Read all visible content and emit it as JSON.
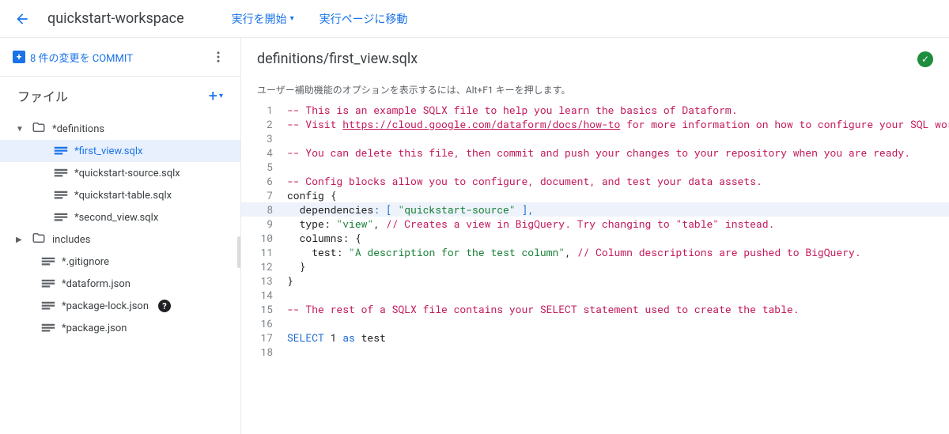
{
  "header": {
    "workspace": "quickstart-workspace",
    "start_execution": "実行を開始",
    "go_to_execution_page": "実行ページに移動"
  },
  "sidebar": {
    "commit_label": "8 件の変更を COMMIT",
    "files_title": "ファイル",
    "tree": {
      "definitions": "*definitions",
      "first_view": "*first_view.sqlx",
      "quickstart_source": "*quickstart-source.sqlx",
      "quickstart_table": "*quickstart-table.sqlx",
      "second_view": "*second_view.sqlx",
      "includes": "includes",
      "gitignore": "*.gitignore",
      "dataform_json": "*dataform.json",
      "package_lock": "*package-lock.json",
      "package_json": "*package.json"
    }
  },
  "content": {
    "file_path": "definitions/first_view.sqlx",
    "a11y_hint": "ユーザー補助機能のオプションを表示するには、Alt+F1 キーを押します。"
  },
  "code": {
    "l1_comment": "-- This is an example SQLX file to help you learn the basics of Dataform.",
    "l2_a": "-- Visit ",
    "l2_link": "https://cloud.google.com/dataform/docs/how-to",
    "l2_b": " for more information on how to configure your SQL workflo",
    "l4": "-- You can delete this file, then commit and push your changes to your repository when you are ready.",
    "l6": "-- Config blocks allow you to configure, document, and test your data assets.",
    "l7": "config {",
    "l8_key": "  dependencies",
    "l8_punc1": ": [ ",
    "l8_str": "\"quickstart-source\"",
    "l8_punc2": " ],",
    "l9_key": "  type",
    "l9_punc": ": ",
    "l9_str": "\"view\"",
    "l9_comma": ", ",
    "l9_comment": "// Creates a view in BigQuery. Try changing to \"table\" instead.",
    "l10_key": "  columns",
    "l10_rest": ": {",
    "l11_key": "    test",
    "l11_punc": ": ",
    "l11_str": "\"A description for the test column\"",
    "l11_comma": ", ",
    "l11_comment": "// Column descriptions are pushed to BigQuery.",
    "l12": "  }",
    "l13": "}",
    "l15": "-- The rest of a SQLX file contains your SELECT statement used to create the table.",
    "l17_select": "SELECT",
    "l17_num": " 1 ",
    "l17_as": "as",
    "l17_col": " test"
  },
  "gutter": {
    "n1": "1",
    "n2": "2",
    "n3": "3",
    "n4": "4",
    "n5": "5",
    "n6": "6",
    "n7": "7",
    "n8": "8",
    "n9": "9",
    "n10": "10",
    "n11": "11",
    "n12": "12",
    "n13": "13",
    "n14": "14",
    "n15": "15",
    "n16": "16",
    "n17": "17",
    "n18": "18"
  }
}
